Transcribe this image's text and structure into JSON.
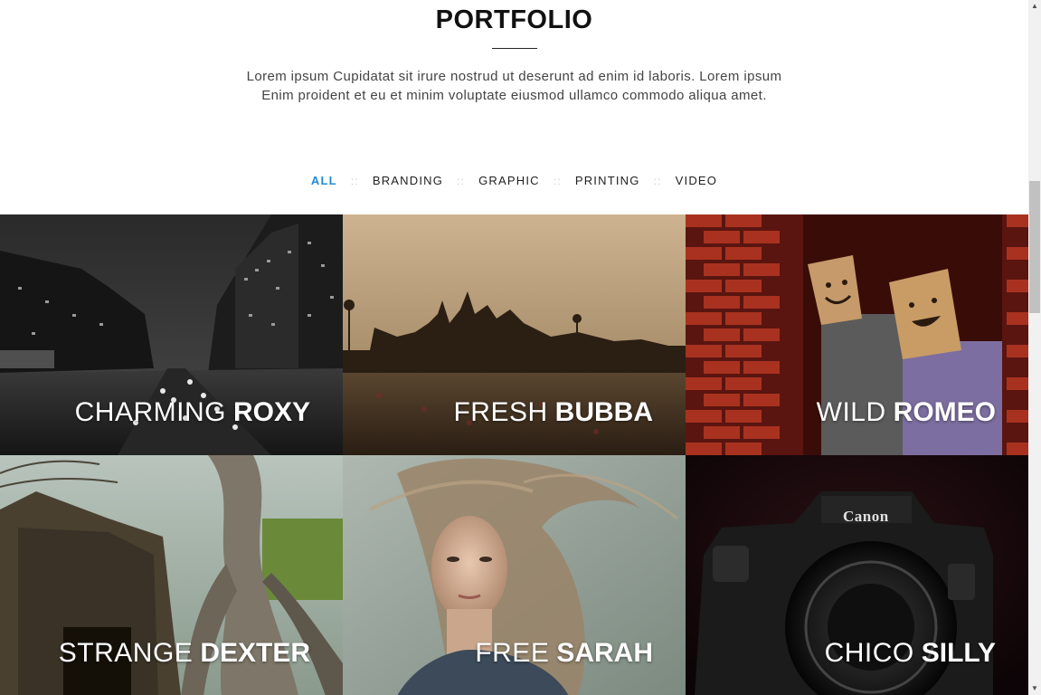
{
  "section": {
    "title": "PORTFOLIO",
    "intro_line1": "Lorem ipsum Cupidatat sit irure nostrud ut deserunt ad enim id laboris. Lorem ipsum",
    "intro_line2": "Enim proident et eu et minim voluptate eiusmod ullamco commodo aliqua amet."
  },
  "filters": {
    "items": [
      {
        "label": "ALL",
        "active": true
      },
      {
        "label": "BRANDING",
        "active": false
      },
      {
        "label": "GRAPHIC",
        "active": false
      },
      {
        "label": "PRINTING",
        "active": false
      },
      {
        "label": "VIDEO",
        "active": false
      }
    ],
    "separator": "::",
    "active_color": "#1f8dd6"
  },
  "portfolio": {
    "items": [
      {
        "light": "CHARMING",
        "bold": "ROXY",
        "image": "city-night-street"
      },
      {
        "light": "FRESH",
        "bold": "BUBBA",
        "image": "temple-sunset-silhouette"
      },
      {
        "light": "WILD",
        "bold": "ROMEO",
        "image": "paper-bag-couple-brick-wall"
      },
      {
        "light": "STRANGE",
        "bold": "DEXTER",
        "image": "jungle-temple-ruins"
      },
      {
        "light": "FREE",
        "bold": "SARAH",
        "image": "woman-windblown-hair"
      },
      {
        "light": "CHICO",
        "bold": "SILLY",
        "image": "canon-camera"
      }
    ],
    "camera_brand": "Canon"
  }
}
